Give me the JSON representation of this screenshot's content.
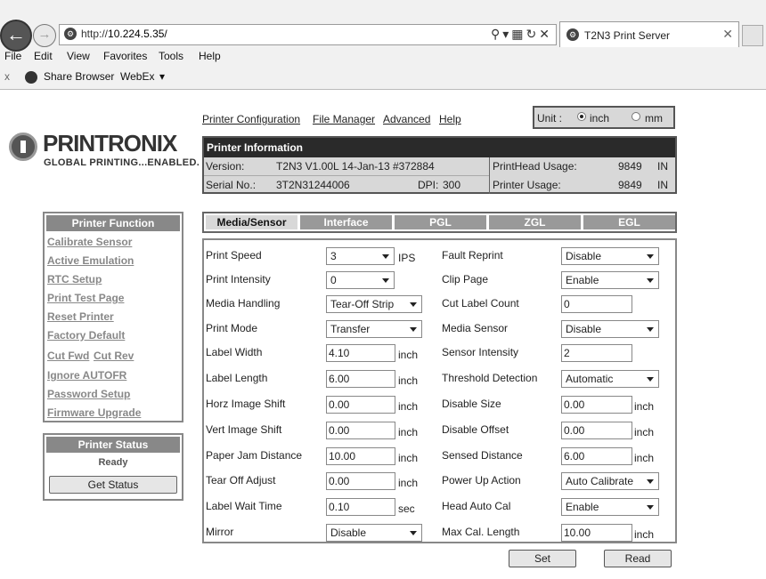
{
  "browser": {
    "url_prefix": "http://",
    "url_host": "10.224.5.35/",
    "tab_title": "T2N3 Print Server",
    "menu": [
      "File",
      "Edit",
      "View",
      "Favorites",
      "Tools",
      "Help"
    ],
    "favorites": {
      "close": "x",
      "share": "Share Browser",
      "webex": "WebEx"
    }
  },
  "logo": {
    "name": "PRINTRONIX",
    "tagline": "GLOBAL PRINTING...ENABLED."
  },
  "topnav": {
    "links": [
      "Printer Configuration",
      "File Manager",
      "Advanced",
      "Help"
    ],
    "unit_label": "Unit :",
    "unit_inch": "inch",
    "unit_mm": "mm",
    "unit_selected": "inch"
  },
  "info": {
    "title": "Printer Information",
    "version_label": "Version:",
    "version_value": "T2N3 V1.00L 14-Jan-13 #372884",
    "serial_label": "Serial No.:",
    "serial_value": "3T2N31244006",
    "dpi_label": "DPI:",
    "dpi_value": "300",
    "printhead_label": "PrintHead Usage:",
    "printhead_value": "9849",
    "printhead_unit": "IN",
    "printer_usage_label": "Printer Usage:",
    "printer_usage_value": "9849",
    "printer_usage_unit": "IN"
  },
  "sidebar": {
    "title": "Printer Function",
    "items": [
      "Calibrate Sensor",
      "Active Emulation",
      "RTC Setup",
      "Print Test Page",
      "Reset Printer",
      "Factory Default",
      "Cut Fwd",
      "Cut Rev",
      "Ignore AUTOFR",
      "Password Setup",
      "Firmware Upgrade"
    ]
  },
  "status": {
    "title": "Printer Status",
    "value": "Ready",
    "button": "Get Status"
  },
  "tabs": [
    "Media/Sensor",
    "Interface",
    "PGL",
    "ZGL",
    "EGL"
  ],
  "left_fields": [
    {
      "label": "Print Speed",
      "value": "3",
      "unit": "IPS",
      "type": "select"
    },
    {
      "label": "Print Intensity",
      "value": "0",
      "unit": "",
      "type": "select"
    },
    {
      "label": "Media Handling",
      "value": "Tear-Off Strip",
      "unit": "",
      "type": "select"
    },
    {
      "label": "Print Mode",
      "value": "Transfer",
      "unit": "",
      "type": "select"
    },
    {
      "label": "Label Width",
      "value": "4.10",
      "unit": "inch",
      "type": "input"
    },
    {
      "label": "Label Length",
      "value": "6.00",
      "unit": "inch",
      "type": "input"
    },
    {
      "label": "Horz Image Shift",
      "value": "0.00",
      "unit": "inch",
      "type": "input"
    },
    {
      "label": "Vert Image Shift",
      "value": "0.00",
      "unit": "inch",
      "type": "input"
    },
    {
      "label": "Paper Jam Distance",
      "value": "10.00",
      "unit": "inch",
      "type": "input"
    },
    {
      "label": "Tear Off Adjust",
      "value": "0.00",
      "unit": "inch",
      "type": "input"
    },
    {
      "label": "Label Wait Time",
      "value": "0.10",
      "unit": "sec",
      "type": "input"
    },
    {
      "label": "Mirror",
      "value": "Disable",
      "unit": "",
      "type": "select"
    }
  ],
  "right_fields": [
    {
      "label": "Fault Reprint",
      "value": "Disable",
      "unit": "",
      "type": "select"
    },
    {
      "label": "Clip Page",
      "value": "Enable",
      "unit": "",
      "type": "select"
    },
    {
      "label": "Cut Label Count",
      "value": "0",
      "unit": "",
      "type": "input"
    },
    {
      "label": "Media Sensor",
      "value": "Disable",
      "unit": "",
      "type": "select"
    },
    {
      "label": "Sensor Intensity",
      "value": "2",
      "unit": "",
      "type": "input"
    },
    {
      "label": "Threshold Detection",
      "value": "Automatic",
      "unit": "",
      "type": "select"
    },
    {
      "label": "Disable Size",
      "value": "0.00",
      "unit": "inch",
      "type": "input"
    },
    {
      "label": "Disable Offset",
      "value": "0.00",
      "unit": "inch",
      "type": "input"
    },
    {
      "label": "Sensed Distance",
      "value": "6.00",
      "unit": "inch",
      "type": "input"
    },
    {
      "label": "Power Up Action",
      "value": "Auto Calibrate",
      "unit": "",
      "type": "select"
    },
    {
      "label": "Head Auto Cal",
      "value": "Enable",
      "unit": "",
      "type": "select"
    },
    {
      "label": "Max Cal. Length",
      "value": "10.00",
      "unit": "inch",
      "type": "input"
    }
  ],
  "buttons": {
    "set": "Set",
    "read": "Read"
  }
}
